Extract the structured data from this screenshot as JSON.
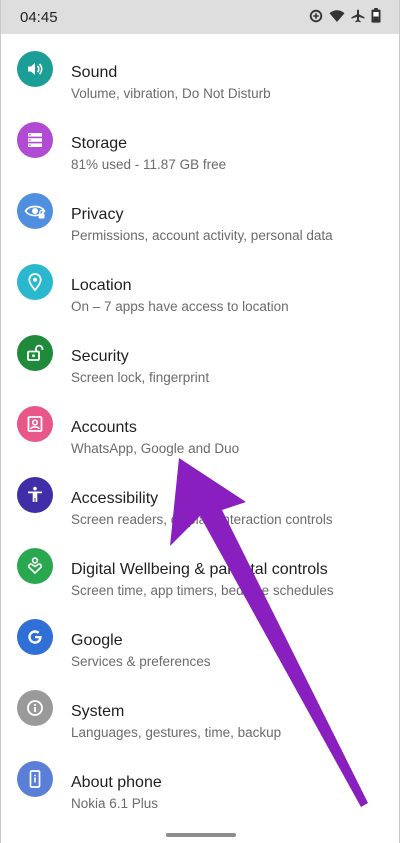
{
  "status_bar": {
    "time": "04:45",
    "icons": [
      "data-saver-icon",
      "wifi-icon",
      "airplane-icon",
      "battery-icon"
    ]
  },
  "settings": [
    {
      "title": "Sound",
      "subtitle": "Volume, vibration, Do Not Disturb",
      "icon": "volume-icon",
      "color": "#1a9e95"
    },
    {
      "title": "Storage",
      "subtitle": "81% used - 11.87 GB free",
      "icon": "storage-icon",
      "color": "#b14bd3"
    },
    {
      "title": "Privacy",
      "subtitle": "Permissions, account activity, personal data",
      "icon": "privacy-eye-icon",
      "color": "#4f8fe0"
    },
    {
      "title": "Location",
      "subtitle": "On – 7 apps have access to location",
      "icon": "location-pin-icon",
      "color": "#2ab8cf"
    },
    {
      "title": "Security",
      "subtitle": "Screen lock, fingerprint",
      "icon": "lock-open-icon",
      "color": "#1e8a3a"
    },
    {
      "title": "Accounts",
      "subtitle": "WhatsApp, Google and Duo",
      "icon": "account-box-icon",
      "color": "#e8568a"
    },
    {
      "title": "Accessibility",
      "subtitle": "Screen readers, display, interaction controls",
      "icon": "accessibility-icon",
      "color": "#3f2ea8"
    },
    {
      "title": "Digital Wellbeing & parental controls",
      "subtitle": "Screen time, app timers, bedtime schedules",
      "icon": "wellbeing-heart-icon",
      "color": "#29a84f"
    },
    {
      "title": "Google",
      "subtitle": "Services & preferences",
      "icon": "google-g-icon",
      "color": "#2f6fd6"
    },
    {
      "title": "System",
      "subtitle": "Languages, gestures, time, backup",
      "icon": "info-icon",
      "color": "#9a9a9a"
    },
    {
      "title": "About phone",
      "subtitle": "Nokia 6.1 Plus",
      "icon": "phone-info-icon",
      "color": "#5b7fd6"
    }
  ],
  "annotation_arrow": {
    "color": "#8a1fc0",
    "points_to": "Accounts"
  }
}
